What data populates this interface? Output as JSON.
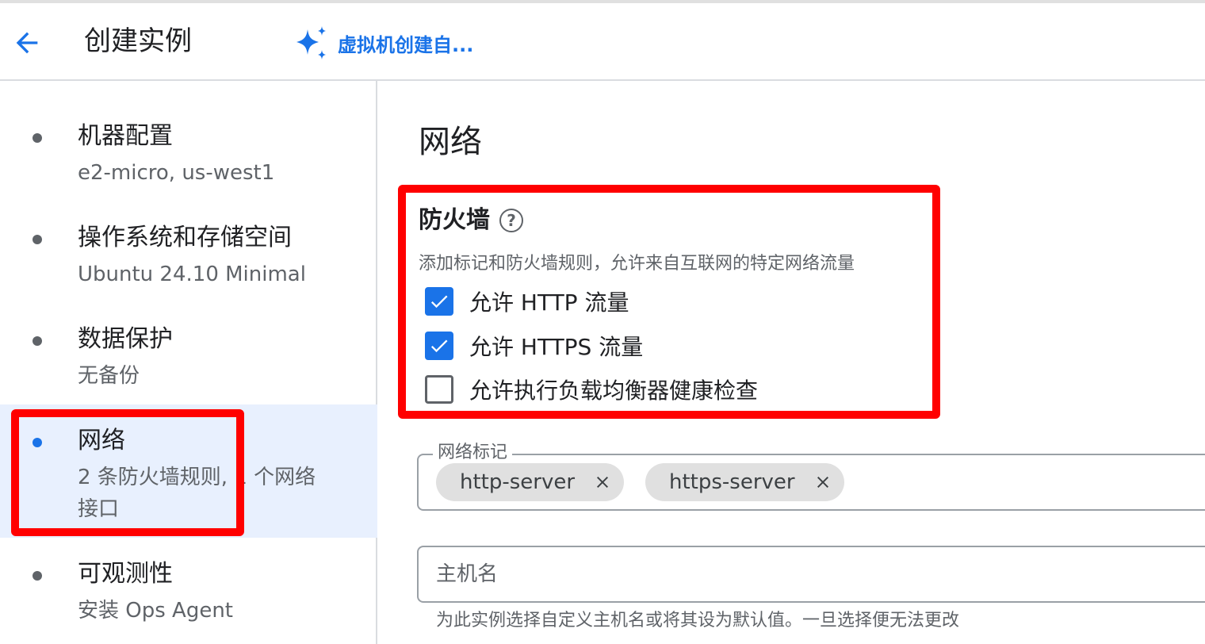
{
  "header": {
    "back_icon": "arrow-back-icon",
    "title": "创建实例",
    "ai_link_label": "虚拟机创建自...",
    "ai_icon": "sparkle-icon"
  },
  "sidebar": {
    "items": [
      {
        "title": "机器配置",
        "subtitle": "e2-micro, us-west1",
        "active": false
      },
      {
        "title": "操作系统和存储空间",
        "subtitle": "Ubuntu 24.10 Minimal",
        "active": false
      },
      {
        "title": "数据保护",
        "subtitle": "无备份",
        "active": false
      },
      {
        "title": "网络",
        "subtitle": "2 条防火墙规则, 1 个网络接口",
        "active": true
      },
      {
        "title": "可观测性",
        "subtitle": "安装 Ops Agent",
        "active": false
      }
    ]
  },
  "main": {
    "section_title": "网络",
    "firewall": {
      "title": "防火墙",
      "help_icon": "help-icon",
      "description": "添加标记和防火墙规则，允许来自互联网的特定网络流量",
      "options": [
        {
          "label": "允许 HTTP 流量",
          "checked": true
        },
        {
          "label": "允许 HTTPS 流量",
          "checked": true
        },
        {
          "label": "允许执行负载均衡器健康检查",
          "checked": false
        }
      ]
    },
    "network_tags": {
      "label": "网络标记",
      "chips": [
        "http-server",
        "https-server"
      ]
    },
    "hostname": {
      "placeholder": "主机名",
      "hint": "为此实例选择自定义主机名或将其设为默认值。一旦选择便无法更改"
    }
  },
  "colors": {
    "accent": "#1a73e8",
    "highlight_box": "#ff0000",
    "active_nav_bg": "#e8f0fe"
  }
}
